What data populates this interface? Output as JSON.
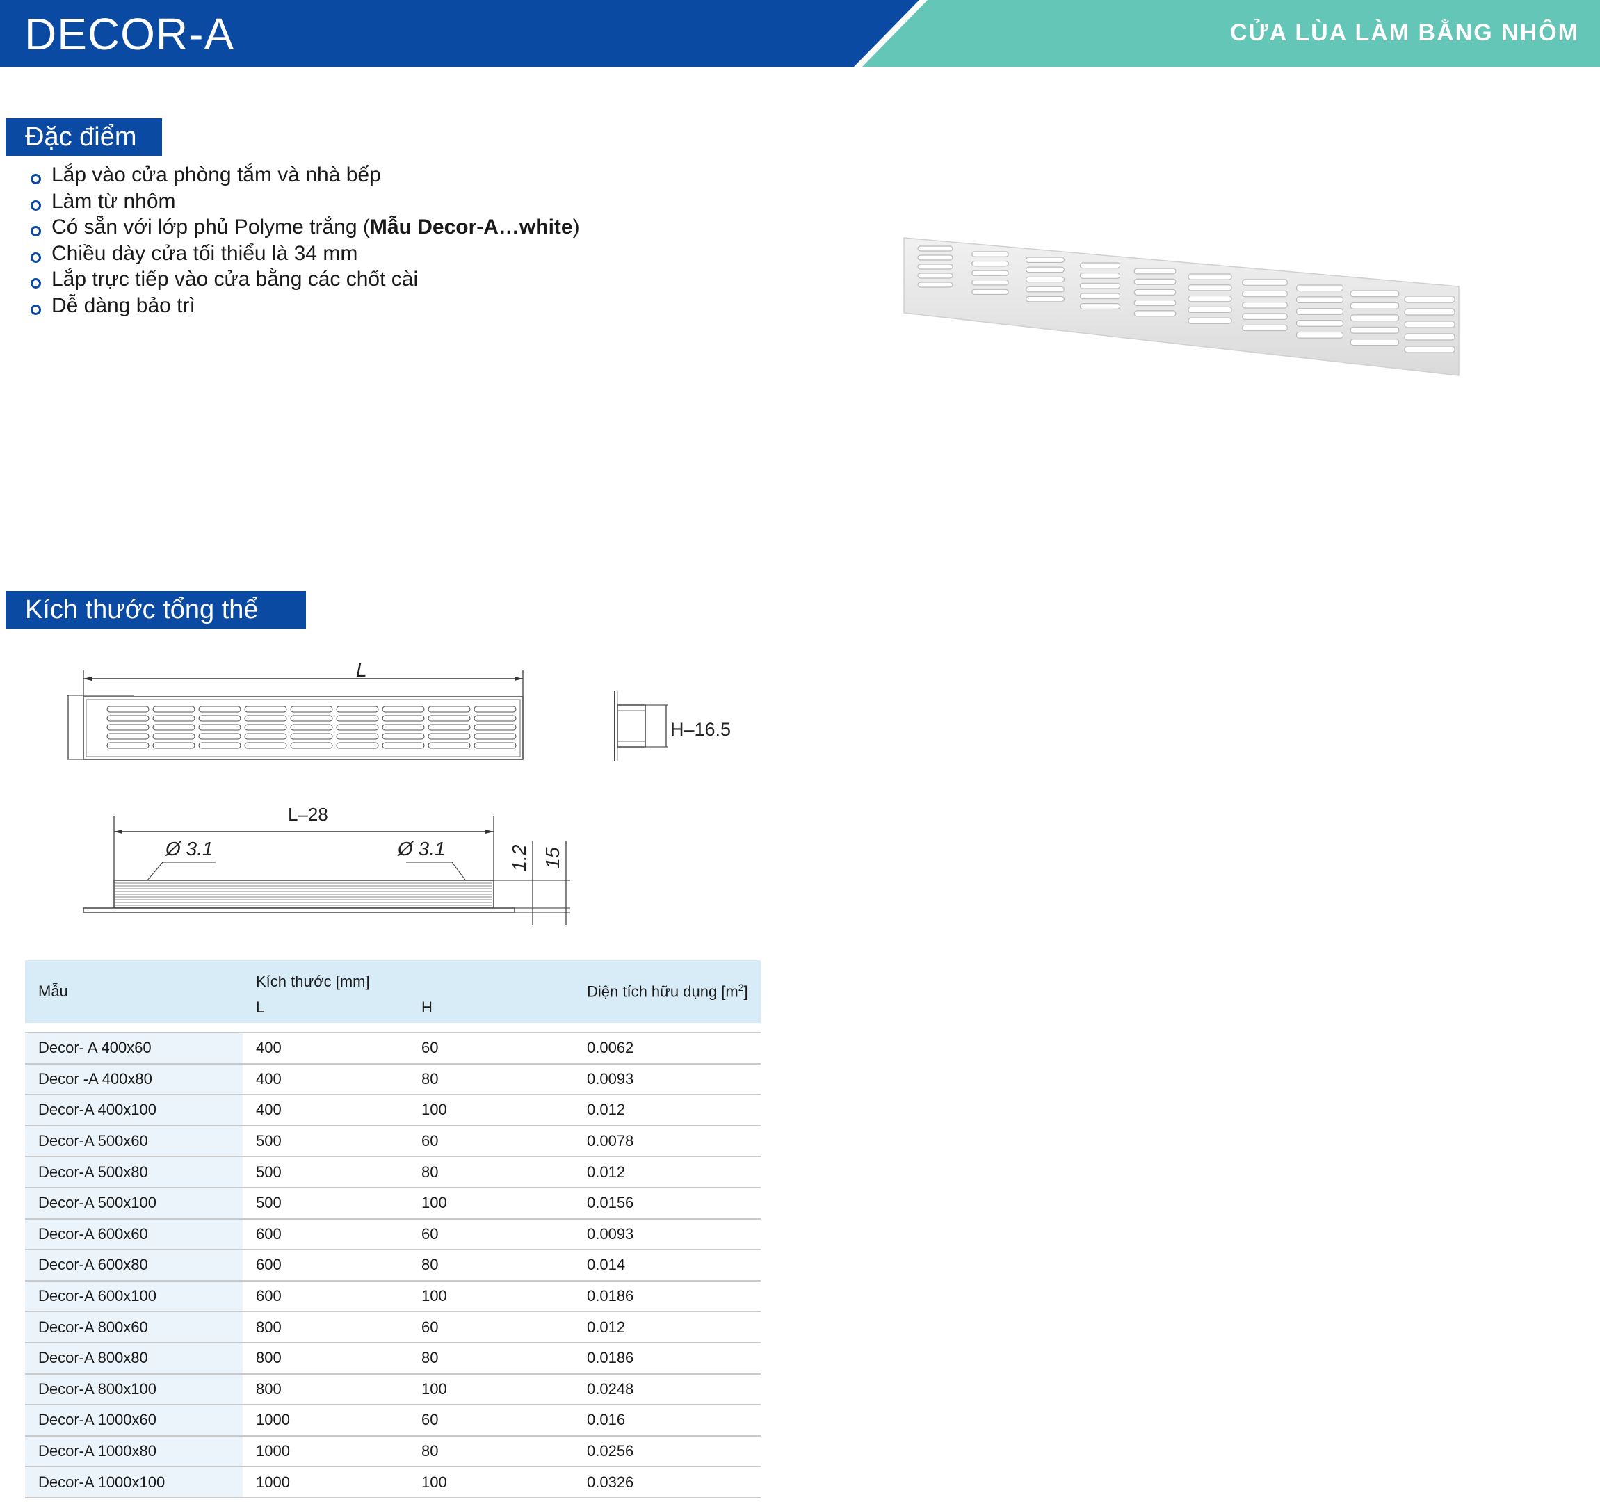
{
  "header": {
    "title": "DECOR-A",
    "category": "CỬA LÙA LÀM BẰNG NHÔM",
    "colors": {
      "blue": "#0b4aa2",
      "teal": "#63c6b6"
    }
  },
  "features_section": {
    "label": "Đặc điểm",
    "items": [
      {
        "text": "Lắp vào cửa phòng tắm và nhà bếp"
      },
      {
        "text": "Làm từ nhôm"
      },
      {
        "text": "Có sẵn với lớp phủ Polyme trắng (",
        "bold": "Mẫu Decor-A…white",
        "after": ")"
      },
      {
        "text": "Chiều dày cửa tối thiểu là 34 mm"
      },
      {
        "text": "Lắp trực tiếp vào cửa bằng các chốt cài"
      },
      {
        "text": "Dễ dàng bảo trì"
      }
    ]
  },
  "dimensions_section": {
    "label": "Kích thước tổng thể",
    "drawing_labels": {
      "length": "L",
      "height": "H",
      "side_height": "H–16.5",
      "mount_length": "L–28",
      "hole_left": "Ø 3.1",
      "hole_right": "Ø 3.1",
      "thickness": "1.2",
      "depth": "15"
    }
  },
  "table": {
    "headers": {
      "model": "Mẫu",
      "size_group": "Kích thước [mm]",
      "length": "L",
      "height": "H",
      "area": "Diện tích hữu dụng [m",
      "area_sup": "2",
      "area_close": "]"
    },
    "rows": [
      [
        "Decor- A 400x60",
        "400",
        "60",
        "0.0062"
      ],
      [
        "Decor -A 400x80",
        "400",
        "80",
        "0.0093"
      ],
      [
        "Decor-A 400x100",
        "400",
        "100",
        "0.012"
      ],
      [
        "Decor-A 500x60",
        "500",
        "60",
        "0.0078"
      ],
      [
        "Decor-A 500x80",
        "500",
        "80",
        "0.012"
      ],
      [
        "Decor-A 500x100",
        "500",
        "100",
        "0.0156"
      ],
      [
        "Decor-A 600x60",
        "600",
        "60",
        "0.0093"
      ],
      [
        "Decor-A 600x80",
        "600",
        "80",
        "0.014"
      ],
      [
        "Decor-A 600x100",
        "600",
        "100",
        "0.0186"
      ],
      [
        "Decor-A 800x60",
        "800",
        "60",
        "0.012"
      ],
      [
        "Decor-A 800x80",
        "800",
        "80",
        "0.0186"
      ],
      [
        "Decor-A 800x100",
        "800",
        "100",
        "0.0248"
      ],
      [
        "Decor-A 1000x60",
        "1000",
        "60",
        "0.016"
      ],
      [
        "Decor-A 1000x80",
        "1000",
        "80",
        "0.0256"
      ],
      [
        "Decor-A 1000x100",
        "1000",
        "100",
        "0.0326"
      ]
    ]
  }
}
